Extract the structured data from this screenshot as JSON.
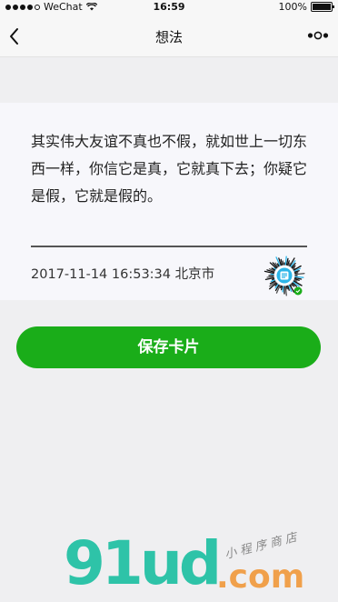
{
  "status_bar": {
    "carrier": "WeChat",
    "time": "16:59",
    "battery": "100%"
  },
  "nav": {
    "title": "想法"
  },
  "card": {
    "quote_lines": [
      "其实伟大友谊不真也不假，就如世上一切东",
      "西一样，你信它是真，它就真下去；你疑它",
      "是假，它就是假的。"
    ],
    "datetime": "2017-11-14 16:53:34",
    "location": "北京市"
  },
  "actions": {
    "save_label": "保存卡片"
  },
  "watermark": {
    "main": "91ud",
    "domain": ".com",
    "sub": "小程序商店"
  },
  "colors": {
    "primary_green": "#1aad19",
    "card_bg": "#f7f7fb",
    "page_bg": "#efeff1"
  }
}
